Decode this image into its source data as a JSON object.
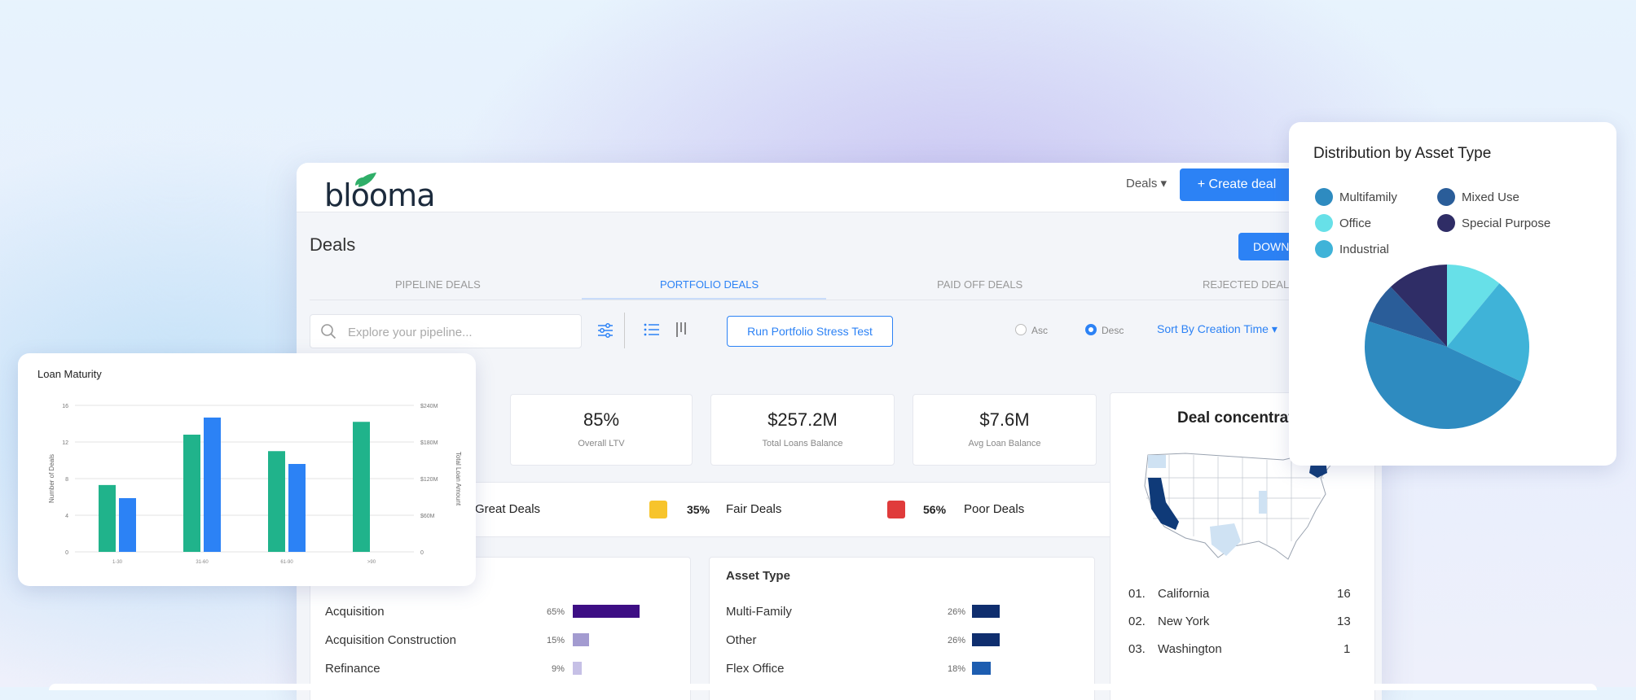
{
  "app": {
    "logo": "blooma",
    "nav_deals": "Deals ▾",
    "create_deal": "+ Create deal",
    "page_title": "Deals",
    "download": "DOWNL"
  },
  "tabs": [
    {
      "label": "PIPELINE DEALS"
    },
    {
      "label": "PORTFOLIO DEALS"
    },
    {
      "label": "PAID OFF DEALS"
    },
    {
      "label": "REJECTED DEALS"
    }
  ],
  "toolbar": {
    "search_placeholder": "Explore your pipeline...",
    "stress_test": "Run Portfolio Stress Test",
    "asc": "Asc",
    "desc": "Desc",
    "sort": "Sort By Creation Time ▾"
  },
  "stats": [
    {
      "value": "85%",
      "label": "Overall LTV"
    },
    {
      "value": "$257.2M",
      "label": "Total Loans Balance"
    },
    {
      "value": "$7.6M",
      "label": "Avg Loan Balance"
    }
  ],
  "quality": [
    {
      "pct": "",
      "label": "Great Deals",
      "color": "#2fb37e"
    },
    {
      "pct": "35%",
      "label": "Fair Deals",
      "color": "#f7c42b"
    },
    {
      "pct": "56%",
      "label": "Poor Deals",
      "color": "#e03b3b"
    }
  ],
  "purpose": {
    "rows": [
      {
        "label": "Acquisition",
        "pct": "65%",
        "value": 65,
        "color": "#3d0e84"
      },
      {
        "label": "Acquisition Construction",
        "pct": "15%",
        "value": 15,
        "color": "#a39bd0"
      },
      {
        "label": "Refinance",
        "pct": "9%",
        "value": 9,
        "color": "#c6c0e6"
      }
    ]
  },
  "asset_type": {
    "title": "Asset Type",
    "rows": [
      {
        "label": "Multi-Family",
        "pct": "26%",
        "value": 26,
        "color": "#0f2e6e"
      },
      {
        "label": "Other",
        "pct": "26%",
        "value": 26,
        "color": "#0f2e6e"
      },
      {
        "label": "Flex Office",
        "pct": "18%",
        "value": 18,
        "color": "#1d5db0"
      }
    ]
  },
  "concentration": {
    "title": "Deal concentrati",
    "states": [
      {
        "rank": "01.",
        "name": "California",
        "count": "16"
      },
      {
        "rank": "02.",
        "name": "New York",
        "count": "13"
      },
      {
        "rank": "03.",
        "name": "Washington",
        "count": "1"
      }
    ]
  },
  "loan_maturity": {
    "title": "Loan Maturity",
    "left_axis_label": "Number of Deals",
    "right_axis_label": "Total Loan Amount",
    "left_ticks": [
      "0",
      "4",
      "8",
      "12",
      "16"
    ],
    "right_ticks": [
      "0",
      "$60M",
      "$120M",
      "$180M",
      "$240M"
    ],
    "categories": [
      "1-30",
      "31-60",
      "61-90",
      ">90"
    ]
  },
  "distribution": {
    "title": "Distribution by Asset Type",
    "legend": [
      {
        "label": "Multifamily",
        "color": "#2e8bc0"
      },
      {
        "label": "Mixed Use",
        "color": "#2a5d99"
      },
      {
        "label": "Office",
        "color": "#67e0e8"
      },
      {
        "label": "Special Purpose",
        "color": "#2f2d66"
      },
      {
        "label": "Industrial",
        "color": "#3fb3d8"
      }
    ]
  },
  "chart_data": [
    {
      "type": "bar",
      "title": "Loan Maturity",
      "categories": [
        "1-30",
        "31-60",
        "61-90",
        ">90"
      ],
      "ylabel": "Number of Deals",
      "y2label": "Total Loan Amount",
      "ylim": [
        0,
        16
      ],
      "y2lim": [
        0,
        240
      ],
      "series": [
        {
          "axis": "left",
          "color": "#20b38b",
          "values": [
            7.3,
            12.8,
            11,
            14.2
          ]
        },
        {
          "axis": "right",
          "color": "#2c82f5",
          "values": [
            88,
            220,
            144,
            null
          ]
        }
      ],
      "grid": true
    },
    {
      "type": "pie",
      "title": "Distribution by Asset Type",
      "labels": [
        "Office",
        "Industrial",
        "Multifamily",
        "Mixed Use",
        "Special Purpose"
      ],
      "values": [
        11,
        21,
        48,
        8,
        12
      ],
      "colors": [
        "#67e0e8",
        "#3fb3d8",
        "#2e8bc0",
        "#2a5d99",
        "#2f2d66"
      ],
      "legend": "top"
    }
  ]
}
